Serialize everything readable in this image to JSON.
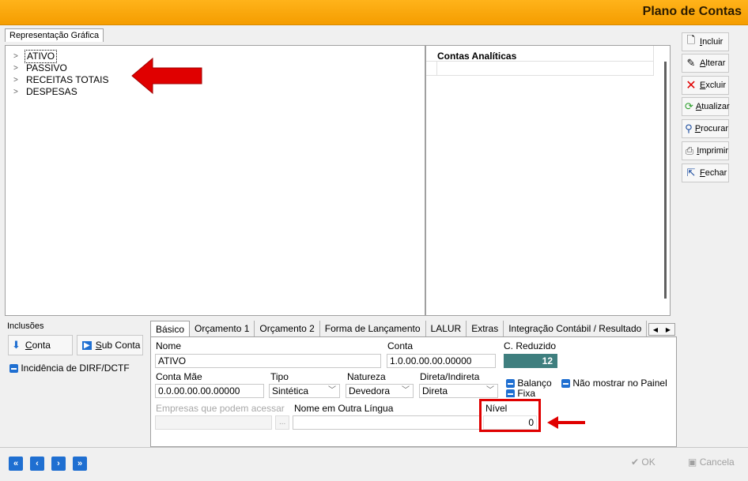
{
  "window": {
    "title": "Plano de Contas"
  },
  "tree_tab": {
    "label": "Representação Gráfica"
  },
  "tree": {
    "items": [
      "ATIVO",
      "PASSIVO",
      "RECEITAS TOTAIS",
      "DESPESAS"
    ]
  },
  "analytic": {
    "header": "Contas Analíticas"
  },
  "sidebar": {
    "incluir": "Incluir",
    "alterar": "Alterar",
    "excluir": "Excluir",
    "atualizar": "Atualizar",
    "procurar": "Procurar",
    "imprimir": "Imprimir",
    "fechar": "Fechar"
  },
  "inclusoes": {
    "title": "Inclusões",
    "conta_btn": "Conta",
    "subconta_btn": "Sub Conta",
    "dirf_label": "Incidência de DIRF/DCTF"
  },
  "tabs": [
    "Básico",
    "Orçamento 1",
    "Orçamento 2",
    "Forma de Lançamento",
    "LALUR",
    "Extras",
    "Integração Contábil / Resultado"
  ],
  "form": {
    "nome_label": "Nome",
    "nome_value": "ATIVO",
    "conta_label": "Conta",
    "conta_value": "1.0.00.00.00.00000",
    "creduzido_label": "C. Reduzido",
    "creduzido_value": "12",
    "contamae_label": "Conta Mãe",
    "contamae_value": "0.0.00.00.00.00000",
    "tipo_label": "Tipo",
    "tipo_value": "Sintética",
    "natureza_label": "Natureza",
    "natureza_value": "Devedora",
    "direta_label": "Direta/Indireta",
    "direta_value": "Direta",
    "balanco_label": "Balanço",
    "fixa_label": "Fixa",
    "naomostrar_label": "Não mostrar no Painel",
    "empresas_label": "Empresas que podem acessar",
    "empresas_btn": "...",
    "outralingua_label": "Nome em Outra Língua",
    "nivel_label": "Nível",
    "nivel_value": "0"
  },
  "footer": {
    "ok": "OK",
    "cancela": "Cancela"
  },
  "colors": {
    "title_bar": "#f59d00",
    "accent_blue": "#1f6fd1",
    "annotation_red": "#e00000",
    "creduzido_bg": "#3f7f7f"
  }
}
